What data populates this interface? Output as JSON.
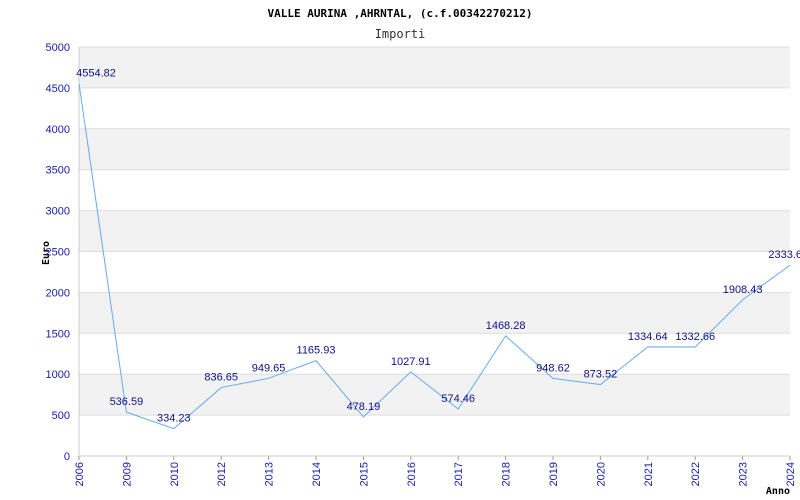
{
  "chart_data": {
    "type": "line",
    "title": "VALLE AURINA ,AHRNTAL, (c.f.00342270212)",
    "subtitle": "Importi",
    "xlabel": "Anno",
    "ylabel": "Euro",
    "ylim": [
      0,
      5000
    ],
    "yticks": [
      0,
      500,
      1000,
      1500,
      2000,
      2500,
      3000,
      3500,
      4000,
      4500,
      5000
    ],
    "grid": true,
    "colors": {
      "line": "#66aaee",
      "band": "#f2f2f2",
      "grid": "#dddddd",
      "tick_text": "#1a1aa6",
      "label_text": "#111188"
    },
    "categories": [
      "2006",
      "2009",
      "2010",
      "2012",
      "2013",
      "2014",
      "2015",
      "2016",
      "2017",
      "2018",
      "2019",
      "2020",
      "2021",
      "2022",
      "2023",
      "2024"
    ],
    "values": [
      4554.82,
      536.59,
      334.23,
      836.65,
      949.65,
      1165.93,
      478.19,
      1027.91,
      574.46,
      1468.28,
      948.62,
      873.52,
      1334.64,
      1332.66,
      1908.43,
      2333.6
    ],
    "labels": [
      "4554.82",
      "536.59",
      "334.23",
      "836.65",
      "949.65",
      "1165.93",
      "478.19",
      "1027.91",
      "574.46",
      "1468.28",
      "948.62",
      "873.52",
      "1334.64",
      "1332.66",
      "1908.43",
      "2333.6"
    ]
  }
}
